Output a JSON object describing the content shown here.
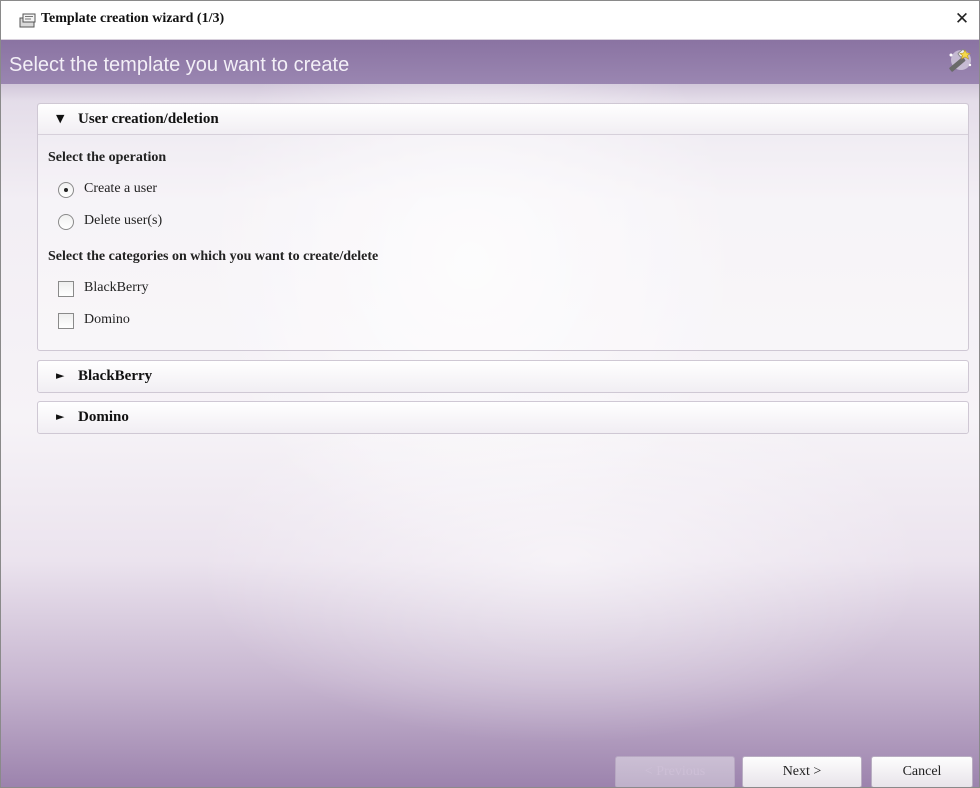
{
  "window": {
    "title": "Template creation wizard (1/3)",
    "close_label": "✕"
  },
  "header": {
    "title": "Select the template you want to create"
  },
  "panels": [
    {
      "label": "User creation/deletion",
      "expanded": true,
      "operation_label": "Select the operation",
      "operations": [
        {
          "label": "Create a user",
          "selected": true
        },
        {
          "label": "Delete user(s)",
          "selected": false
        }
      ],
      "categories_label": "Select the categories on which you want to create/delete",
      "categories": [
        {
          "label": "BlackBerry",
          "checked": false
        },
        {
          "label": "Domino",
          "checked": false
        }
      ]
    },
    {
      "label": "BlackBerry",
      "expanded": false
    },
    {
      "label": "Domino",
      "expanded": false
    }
  ],
  "footer": {
    "previous_label": "< Previous",
    "next_label": "Next >",
    "cancel_label": "Cancel"
  },
  "icons": {
    "expanded": "▼",
    "collapsed": "►"
  },
  "colors": {
    "header_purple": "#8a73a2",
    "background_light": "#f6f3f7"
  }
}
